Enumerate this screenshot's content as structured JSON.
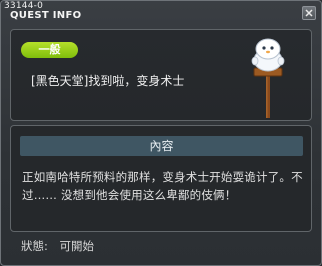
{
  "window": {
    "id_text": "33144-0",
    "title": "QUEST INFO"
  },
  "quest": {
    "category_label": "一般",
    "name": "[黑色天堂]找到啦，变身术士"
  },
  "content": {
    "header": "內容",
    "body": "正如南哈特所预料的那样，变身术士开始耍诡计了。不过…… 没想到他会使用这么卑鄙的伎俩！"
  },
  "status": {
    "label": "狀態:",
    "value": "可開始"
  },
  "colors": {
    "category_badge": "#9ccf1b",
    "content_header": "#3f5663",
    "panel_bg": "#25282b"
  },
  "icons": {
    "npc": "snowman-sign-icon",
    "close": "close-icon"
  }
}
